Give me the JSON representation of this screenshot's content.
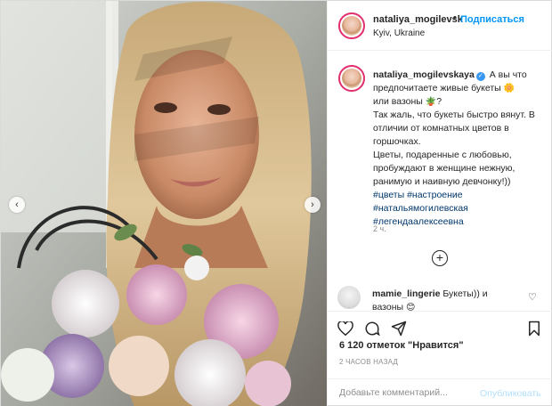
{
  "post": {
    "username": "nataliya_mogilevsk",
    "follow_dot": "•",
    "follow_label": "Подписаться",
    "location": "Kyiv, Ukraine"
  },
  "caption": {
    "username": "nataliya_mogilevskaya",
    "line1": "А вы что",
    "line2": "предпочитаете живые букеты",
    "line3": "или вазоны",
    "line4": "Так жаль, что букеты быстро вянут. В",
    "line5": "отличии от комнатных цветов в",
    "line6": "горшочках.",
    "line7": "Цветы, подаренные с любовью,",
    "line8": "пробуждают в женщине нежную,",
    "line9": "ранимую и наивную девчонку!))",
    "hashtags": [
      "#цветы #настроение",
      "#натальямогилевская",
      "#легендаалексеевна"
    ],
    "time": "2 ч."
  },
  "comment": {
    "username": "mamie_lingerie",
    "text": "Букеты)) и",
    "text2": "вазоны"
  },
  "stats": {
    "likes": "6 120 отметок \"Нравится\"",
    "ago": "2 ЧАСОВ НАЗАД"
  },
  "add_comment": {
    "placeholder": "Добавьте комментарий...",
    "post_label": "Опубликовать"
  },
  "icons": {
    "verified": "verified-badge-icon",
    "like": "heart-icon",
    "comment": "comment-icon",
    "share": "share-icon",
    "save": "bookmark-icon",
    "load_more": "plus-circle-icon"
  },
  "colors": {
    "accent": "#0095f6",
    "story_ring": "#e1306c",
    "hashtag": "#00376b"
  }
}
